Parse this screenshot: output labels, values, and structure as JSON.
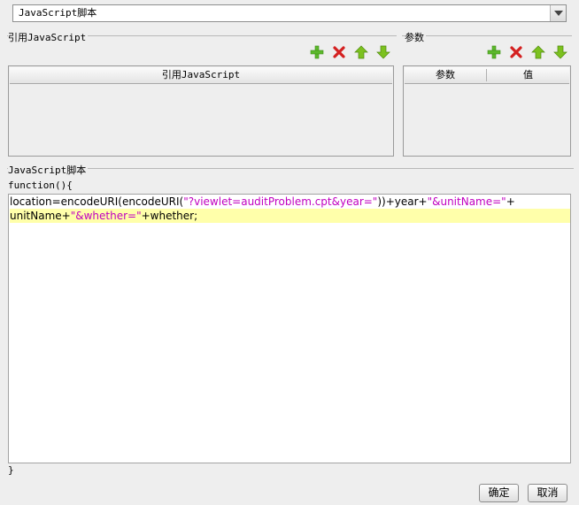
{
  "script_type_select": {
    "value": "JavaScript脚本"
  },
  "ref_js_section": {
    "title": "引用JavaScript",
    "table_header": "引用JavaScript"
  },
  "params_section": {
    "title": "参数",
    "columns": [
      "参数",
      "值"
    ]
  },
  "toolbar_icons": [
    "add-icon",
    "delete-icon",
    "move-up-icon",
    "move-down-icon"
  ],
  "script_section": {
    "title": "JavaScript脚本",
    "function_open": "function(){",
    "function_close": "}",
    "code_lines": [
      [
        {
          "text": "location=encodeURI(encodeURI(",
          "kind": "plain"
        },
        {
          "text": "\"?viewlet=auditProblem.cpt&year=\"",
          "kind": "string"
        },
        {
          "text": "))+year+",
          "kind": "plain"
        },
        {
          "text": "\"&unitName=\"",
          "kind": "string"
        },
        {
          "text": "+",
          "kind": "plain"
        }
      ],
      [
        {
          "text": "unitName+",
          "kind": "plain"
        },
        {
          "text": "\"&whether=\"",
          "kind": "string"
        },
        {
          "text": "+whether;",
          "kind": "plain"
        }
      ]
    ]
  },
  "buttons": {
    "ok": "确定",
    "cancel": "取消"
  },
  "colors": {
    "add": "#5cb82c",
    "delete": "#d42020",
    "arrow": "#7cc11f",
    "string": "#c000c0",
    "highlight": "#ffffaa"
  }
}
